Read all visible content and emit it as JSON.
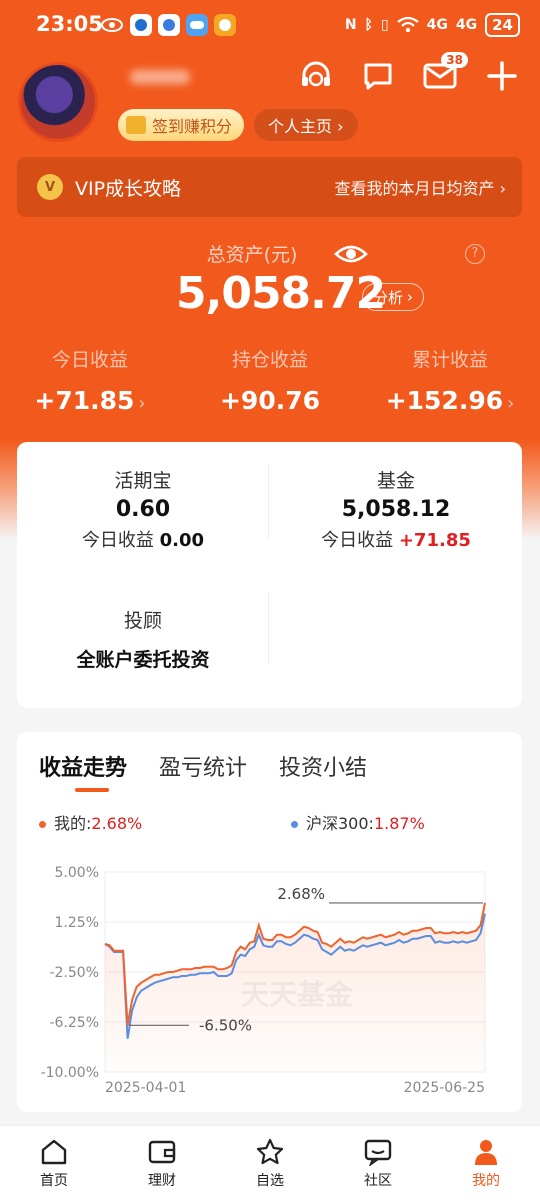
{
  "status": {
    "time": "23:05",
    "battery": "24",
    "net1": "4G",
    "net2": "4G"
  },
  "header": {
    "checkin_label": "签到赚积分",
    "home_label": "个人主页 ›",
    "message_badge": "38"
  },
  "vip": {
    "title": "VIP成长攻略",
    "link": "查看我的本月日均资产 ›"
  },
  "assets": {
    "label": "总资产(元)",
    "value": "5,058.72",
    "analyze_label": "分析",
    "help": "?",
    "stats": [
      {
        "label": "今日收益",
        "value": "+71.85",
        "chevron": "›"
      },
      {
        "label": "持仓收益",
        "value": "+90.76",
        "chevron": ""
      },
      {
        "label": "累计收益",
        "value": "+152.96",
        "chevron": "›"
      }
    ]
  },
  "accounts": [
    {
      "name": "活期宝",
      "value": "0.60",
      "sub_label": "今日收益",
      "sub_value": "0.00"
    },
    {
      "name": "基金",
      "value": "5,058.12",
      "sub_label": "今日收益",
      "sub_value": "+71.85"
    },
    {
      "name": "投顾",
      "value": "全账户委托投资"
    }
  ],
  "trend": {
    "tabs": [
      "收益走势",
      "盈亏统计",
      "投资小结"
    ],
    "legend_mine_label": "我的:",
    "legend_mine_value": "2.68%",
    "legend_hs_label": "沪深300:",
    "legend_hs_value": "1.87%",
    "watermark": "天天基金"
  },
  "colors": {
    "brand": "#f25a1d",
    "mine": "#f0632c",
    "hs300": "#5b8de0",
    "up": "#e02020"
  },
  "chart_data": {
    "type": "line",
    "title": "",
    "xlabel": "",
    "ylabel": "",
    "ylim": [
      -10.0,
      5.0
    ],
    "ytick_labels": [
      "5.00%",
      "1.25%",
      "-2.50%",
      "-6.25%",
      "-10.00%"
    ],
    "yticks": [
      5.0,
      1.25,
      -2.5,
      -6.25,
      -10.0
    ],
    "xtick_labels": [
      "2025-04-01",
      "2025-06-25"
    ],
    "annotations": [
      {
        "text": "2.68%",
        "value": 2.68
      },
      {
        "text": "-6.50%",
        "value": -6.5
      }
    ],
    "series": [
      {
        "name": "我的",
        "color": "#f0632c",
        "values": [
          -0.4,
          -0.5,
          -0.9,
          -0.9,
          -0.9,
          -6.5,
          -4.6,
          -3.6,
          -3.3,
          -3.1,
          -2.9,
          -2.7,
          -2.7,
          -2.6,
          -2.5,
          -2.5,
          -2.4,
          -2.3,
          -2.3,
          -2.3,
          -2.2,
          -2.2,
          -2.1,
          -2.1,
          -2.1,
          -2.3,
          -2.3,
          -2.2,
          -2.0,
          -1.0,
          -0.6,
          -0.8,
          -0.3,
          -0.2,
          1.0,
          0.0,
          -0.1,
          -0.1,
          0.3,
          0.3,
          0.1,
          0.1,
          0.3,
          0.6,
          0.9,
          0.8,
          0.6,
          0.5,
          -0.3,
          -0.4,
          -0.6,
          -0.3,
          0.0,
          -0.3,
          -0.2,
          -0.3,
          -0.1,
          0.1,
          0.0,
          0.1,
          0.2,
          0.3,
          0.1,
          0.2,
          0.3,
          0.5,
          0.3,
          0.4,
          0.6,
          0.6,
          0.7,
          0.8,
          0.8,
          0.4,
          0.5,
          0.4,
          0.4,
          0.5,
          0.4,
          0.5,
          0.4,
          0.5,
          0.6,
          1.0,
          2.68
        ]
      },
      {
        "name": "沪深300",
        "color": "#5b8de0",
        "values": [
          -0.4,
          -0.6,
          -1.0,
          -1.0,
          -1.0,
          -7.5,
          -5.4,
          -4.4,
          -3.9,
          -3.7,
          -3.5,
          -3.3,
          -3.2,
          -3.1,
          -3.0,
          -2.9,
          -2.9,
          -2.8,
          -2.8,
          -2.7,
          -2.7,
          -2.6,
          -2.6,
          -2.6,
          -2.5,
          -2.8,
          -2.8,
          -2.8,
          -2.6,
          -1.6,
          -1.2,
          -1.3,
          -0.8,
          -0.6,
          0.3,
          -0.5,
          -0.6,
          -0.6,
          -0.2,
          -0.2,
          -0.4,
          -0.5,
          -0.3,
          0.0,
          0.3,
          0.2,
          0.0,
          -0.1,
          -0.8,
          -1.0,
          -1.2,
          -0.9,
          -0.6,
          -0.9,
          -0.8,
          -0.9,
          -0.7,
          -0.5,
          -0.6,
          -0.5,
          -0.4,
          -0.3,
          -0.5,
          -0.4,
          -0.3,
          -0.1,
          -0.3,
          -0.2,
          0.0,
          0.0,
          0.1,
          0.2,
          0.2,
          -0.3,
          -0.2,
          -0.3,
          -0.3,
          -0.2,
          -0.3,
          -0.2,
          -0.3,
          -0.2,
          -0.1,
          0.4,
          1.87
        ]
      }
    ]
  },
  "tabbar": [
    {
      "label": "首页"
    },
    {
      "label": "理财"
    },
    {
      "label": "自选"
    },
    {
      "label": "社区"
    },
    {
      "label": "我的"
    }
  ]
}
